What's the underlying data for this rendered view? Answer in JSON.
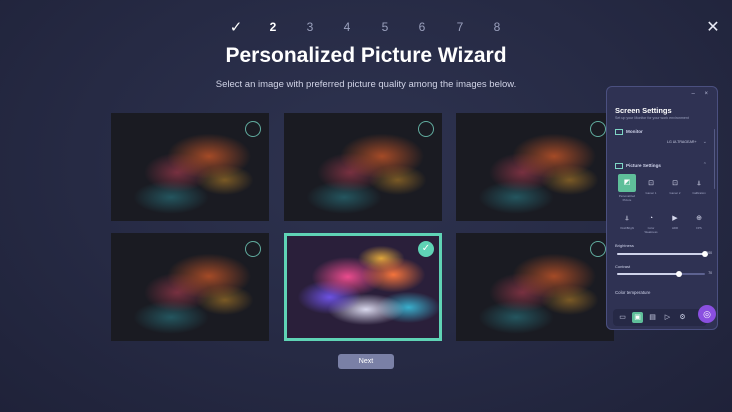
{
  "wizard": {
    "steps": [
      {
        "label": "✓",
        "state": "done"
      },
      {
        "label": "2",
        "state": "current"
      },
      {
        "label": "3",
        "state": "upcoming"
      },
      {
        "label": "4",
        "state": "upcoming"
      },
      {
        "label": "5",
        "state": "upcoming"
      },
      {
        "label": "6",
        "state": "upcoming"
      },
      {
        "label": "7",
        "state": "upcoming"
      },
      {
        "label": "8",
        "state": "upcoming"
      }
    ],
    "close_label": "✕",
    "title": "Personalized Picture Wizard",
    "subtitle": "Select an image with preferred picture quality among the images below.",
    "selected_index": 4,
    "next_label": "Next",
    "accent_color": "#5fd3b5"
  },
  "panel": {
    "window_controls": "–  ×",
    "title": "Screen Settings",
    "subtitle": "Set up your Monitor for your work environment",
    "monitor_label": "Monitor",
    "monitor_model": "LG ULTRAGEAR+",
    "picture_settings_label": "Picture Settings",
    "modes": [
      {
        "label": "Personalized Picture",
        "icon": "personalized-picture-icon",
        "glyph": "◩",
        "active": true
      },
      {
        "label": "Gamer 1",
        "icon": "gamepad-icon",
        "glyph": "⊡",
        "active": false
      },
      {
        "label": "Gamer 2",
        "icon": "gamepad-icon",
        "glyph": "⊡",
        "active": false
      },
      {
        "label": "Calibration",
        "icon": "calibration-icon",
        "glyph": "⍋",
        "active": false
      },
      {
        "label": "Vivid/Bright",
        "icon": "brightness-icon",
        "glyph": "⍋",
        "active": false
      },
      {
        "label": "Color Weakness",
        "icon": "color-weakness-icon",
        "glyph": "◔",
        "active": false
      },
      {
        "label": "HDR",
        "icon": "hdr-icon",
        "glyph": "▶",
        "active": false
      },
      {
        "label": "FPS",
        "icon": "crosshair-icon",
        "glyph": "⊕",
        "active": false
      }
    ],
    "brightness_label": "Brightness",
    "brightness_value": "100",
    "brightness_level": 1.0,
    "contrast_label": "Contrast",
    "contrast_value": "70",
    "contrast_level": 0.7,
    "color_temperature_label": "Color temperature",
    "bottom_bar": [
      {
        "icon": "monitor-icon",
        "glyph": "▭",
        "active": false
      },
      {
        "icon": "picture-icon",
        "glyph": "▣",
        "active": true
      },
      {
        "icon": "layout-icon",
        "glyph": "▤",
        "active": false
      },
      {
        "icon": "video-icon",
        "glyph": "▷",
        "active": false
      },
      {
        "icon": "settings-icon",
        "glyph": "⚙",
        "active": false
      }
    ],
    "fab_glyph": "◎"
  }
}
